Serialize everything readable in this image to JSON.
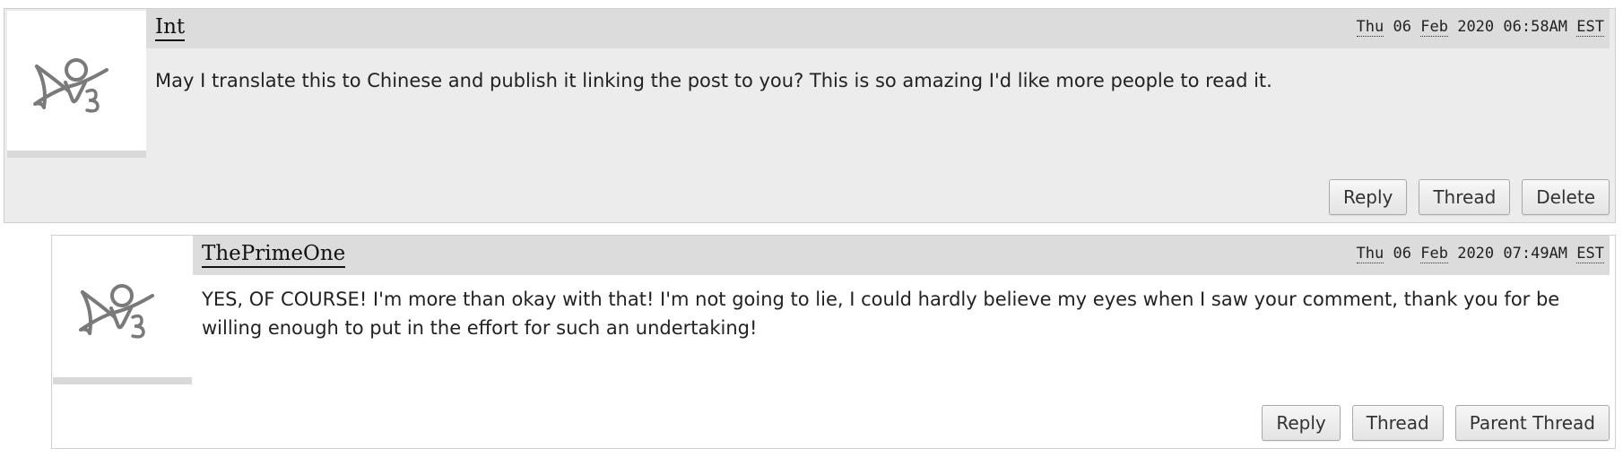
{
  "comments": [
    {
      "username": "Int",
      "timestamp": {
        "day": "Thu",
        "date": "06",
        "month": "Feb",
        "rest": "2020 06:58AM",
        "tz": "EST"
      },
      "body": "May I translate this to Chinese and publish it linking the post to you? This is so amazing I'd like more people to read it.",
      "actions": [
        "Reply",
        "Thread",
        "Delete"
      ]
    },
    {
      "username": "ThePrimeOne",
      "timestamp": {
        "day": "Thu",
        "date": "06",
        "month": "Feb",
        "rest": "2020 07:49AM",
        "tz": "EST"
      },
      "body": "YES, OF COURSE! I'm more than okay with that! I'm not going to lie, I could hardly believe my eyes when I saw your comment, thank you for be willing enough to put in the effort for such an undertaking!",
      "actions": [
        "Reply",
        "Thread",
        "Parent Thread"
      ]
    }
  ],
  "icons": {
    "avatar": "default-user-avatar-icon"
  },
  "colors": {
    "comment1_bg": "#ececec",
    "header_bg": "#dcdcdc",
    "border": "#cfcfcf"
  }
}
